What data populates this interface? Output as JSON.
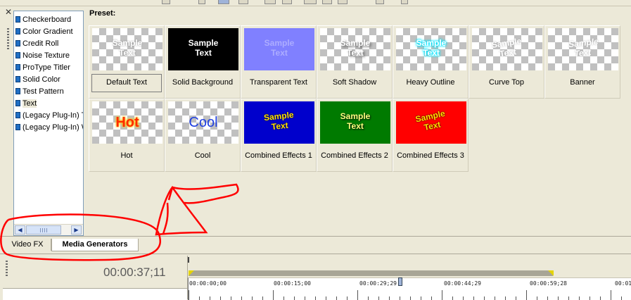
{
  "tree": {
    "items": [
      {
        "label": "Checkerboard"
      },
      {
        "label": "Color Gradient"
      },
      {
        "label": "Credit Roll"
      },
      {
        "label": "Noise Texture"
      },
      {
        "label": "ProType Titler"
      },
      {
        "label": "Solid Color"
      },
      {
        "label": "Test Pattern"
      },
      {
        "label": "Text"
      },
      {
        "label": "(Legacy Plug-In) T"
      },
      {
        "label": "(Legacy Plug-In) W"
      }
    ],
    "selected": "Text"
  },
  "preset": {
    "heading": "Preset:",
    "items": [
      {
        "label": "Default Text",
        "sample": "Sample\nText"
      },
      {
        "label": "Solid Background",
        "sample": "Sample\nText"
      },
      {
        "label": "Transparent Text",
        "sample": "Sample\nText"
      },
      {
        "label": "Soft Shadow",
        "sample": "Sample\nText"
      },
      {
        "label": "Heavy Outline",
        "sample": "Sample\nText"
      },
      {
        "label": "Curve Top",
        "sample": "Sample\nText"
      },
      {
        "label": "Banner",
        "sample": "Sample\nText"
      },
      {
        "label": "Hot",
        "sample": "Hot"
      },
      {
        "label": "Cool",
        "sample": "Cool"
      },
      {
        "label": "Combined Effects 1",
        "sample": "Sample\nText"
      },
      {
        "label": "Combined Effects 2",
        "sample": "Sample\nText"
      },
      {
        "label": "Combined Effects 3",
        "sample": "Sample\nText"
      }
    ],
    "selected": "Default Text"
  },
  "tabs": [
    {
      "label": "Video FX",
      "active": false
    },
    {
      "label": "Media Generators",
      "active": true
    }
  ],
  "timeline": {
    "timecode": "00:00:37;11",
    "ruler": [
      "00:00:00;00",
      "00:00:15;00",
      "00:00:29;29",
      "00:00:44;29",
      "00:00:59;28",
      "00:01"
    ]
  },
  "colors": {
    "annotation": "#ff0000",
    "tree_icon": "#1f6fc5",
    "panel_bg": "#ece9d8"
  }
}
